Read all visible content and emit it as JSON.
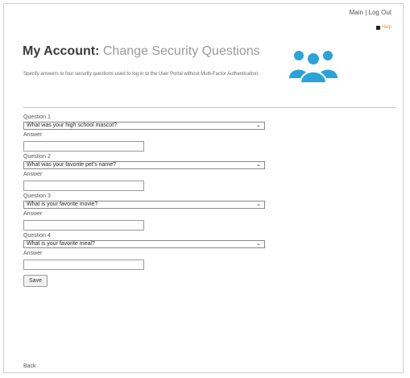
{
  "topnav": {
    "main": "Main",
    "separator": "|",
    "logout": "Log Out"
  },
  "help": {
    "label": "Help"
  },
  "header": {
    "title_bold": "My Account:",
    "title_light": "Change Security Questions",
    "description": "Specify answers to four security questions used to log in to the User Portal without Multi-Factor Authentication."
  },
  "questions": [
    {
      "label": "Question 1",
      "selected": "What was your high school mascot?",
      "answer_label": "Answer",
      "answer_value": ""
    },
    {
      "label": "Question 2",
      "selected": "What was your favorite pet's name?",
      "answer_label": "Answer",
      "answer_value": ""
    },
    {
      "label": "Question 3",
      "selected": "What is your favorite movie?",
      "answer_label": "Answer",
      "answer_value": ""
    },
    {
      "label": "Question 4",
      "selected": "What is your favorite meal?",
      "answer_label": "Answer",
      "answer_value": ""
    }
  ],
  "save_label": "Save",
  "back_label": "Back",
  "colors": {
    "icon_blue": "#2aa3d8",
    "help_orange": "#e3962a"
  }
}
